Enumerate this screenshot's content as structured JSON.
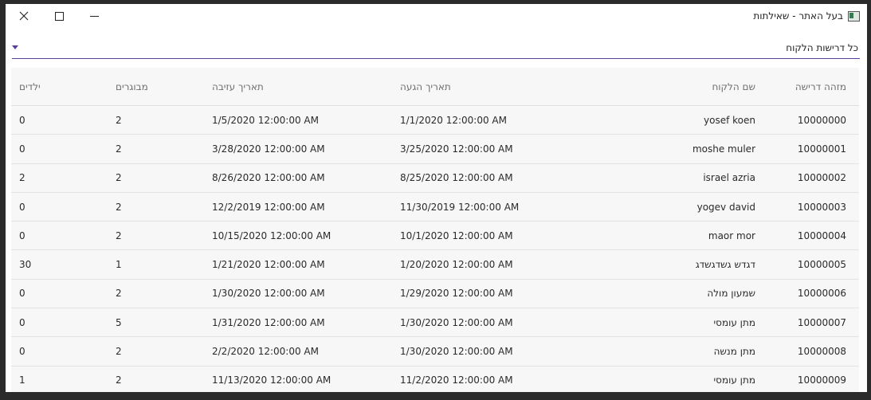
{
  "window": {
    "title": "בעל האתר - שאילתות"
  },
  "selector": {
    "value": "כל דרישות הלקוח"
  },
  "table": {
    "columns": [
      "מזהה דרישה",
      "שם הלקוח",
      "תאריך הגעה",
      "תאריך עזיבה",
      "מבוגרים",
      "ילדים"
    ],
    "rows": [
      [
        "10000000",
        "yosef koen",
        "1/1/2020 12:00:00 AM",
        "1/5/2020 12:00:00 AM",
        "2",
        "0"
      ],
      [
        "10000001",
        "moshe muler",
        "3/25/2020 12:00:00 AM",
        "3/28/2020 12:00:00 AM",
        "2",
        "0"
      ],
      [
        "10000002",
        "israel azria",
        "8/25/2020 12:00:00 AM",
        "8/26/2020 12:00:00 AM",
        "2",
        "2"
      ],
      [
        "10000003",
        "yogev david",
        "11/30/2019 12:00:00 AM",
        "12/2/2019 12:00:00 AM",
        "2",
        "0"
      ],
      [
        "10000004",
        "maor mor",
        "10/1/2020 12:00:00 AM",
        "10/15/2020 12:00:00 AM",
        "2",
        "0"
      ],
      [
        "10000005",
        "דגדש גשדגשדג",
        "1/20/2020 12:00:00 AM",
        "1/21/2020 12:00:00 AM",
        "1",
        "30"
      ],
      [
        "10000006",
        "שמעון מולה",
        "1/29/2020 12:00:00 AM",
        "1/30/2020 12:00:00 AM",
        "2",
        "0"
      ],
      [
        "10000007",
        "מתן עומסי",
        "1/30/2020 12:00:00 AM",
        "1/31/2020 12:00:00 AM",
        "5",
        "0"
      ],
      [
        "10000008",
        "מתן מנשה",
        "1/30/2020 12:00:00 AM",
        "2/2/2020 12:00:00 AM",
        "2",
        "0"
      ],
      [
        "10000009",
        "מתן עומסי",
        "11/2/2020 12:00:00 AM",
        "11/13/2020 12:00:00 AM",
        "2",
        "1"
      ]
    ]
  },
  "colors": {
    "accent": "#5b3f9c",
    "table_background": "#f7f7f7"
  },
  "icons": {
    "close": "close-icon",
    "maximize": "maximize-icon",
    "minimize": "minimize-icon",
    "app": "app-icon",
    "dropdown": "chevron-down-icon"
  }
}
